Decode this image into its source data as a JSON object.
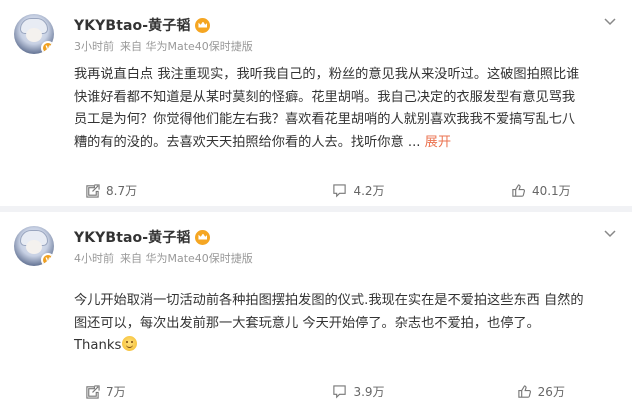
{
  "posts": [
    {
      "username": "YKYBtao-黄子韬",
      "time": "3小时前",
      "source": "来自 华为Mate40保时捷版",
      "content_lines": [
        "我再说直白点 我注重现实，我听我自己的，粉丝的意见我从来没听过。这破图拍照比谁",
        "快谁好看都不知道是从某时莫刻的怪癖。花里胡哨。我自己决定的衣服发型有意见骂我",
        "员工是为何？你觉得他们能左右我？喜欢看花里胡哨的人就别喜欢我我不爱搞写乱七八",
        "糟的有的没的。去喜欢天天拍照给你看的人去。找听你意"
      ],
      "ellipsis": " ... ",
      "expand_label": "展开",
      "actions": {
        "repost": "8.7万",
        "comment": "4.2万",
        "like": "40.1万"
      }
    },
    {
      "username": "YKYBtao-黄子韬",
      "time": "4小时前",
      "source": "来自 华为Mate40保时捷版",
      "content_lines": [
        "今儿开始取消一切活动前各种拍图摆拍发图的仪式.我现在实在是不爱拍这些东西 自然的",
        "图还可以，每次出发前那一大套玩意儿 今天开始停了。杂志也不爱拍，也停了。",
        "Thanks"
      ],
      "emoji": "smile-emoji",
      "actions": {
        "repost": "7万",
        "comment": "3.9万",
        "like": "26万"
      }
    }
  ],
  "colors": {
    "accent": "#eb7350",
    "crown": "#f5a623",
    "meta": "#999999",
    "text": "#333333"
  }
}
